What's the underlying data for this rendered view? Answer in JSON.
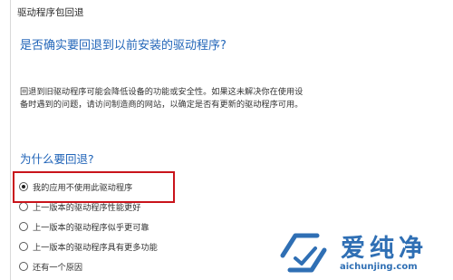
{
  "window": {
    "title": "驱动程序包回退"
  },
  "dialog": {
    "question": "是否确实要回退到以前安装的驱动程序?",
    "description_line1": "回退到旧驱动程序可能会降低设备的功能或安全性。如果这未解决你在使用设",
    "description_line2": "备时遇到的问题，请访问制造商的网站，以确定是否有更新的驱动程序可用。",
    "reason_heading": "为什么要回退?",
    "reasons": [
      {
        "label": "我的应用不使用此驱动程序",
        "selected": true
      },
      {
        "label": "上一版本的驱动程序性能更好",
        "selected": false
      },
      {
        "label": "上一版本的驱动程序似乎更可靠",
        "selected": false
      },
      {
        "label": "上一版本的驱动程序具有更多功能",
        "selected": false
      },
      {
        "label": "还有一个原因",
        "selected": false
      }
    ]
  },
  "watermark": {
    "brand": "爱纯净",
    "url": "aichunjing.com",
    "color": "#2f6fb4"
  },
  "colors": {
    "heading": "#2366b9",
    "highlight_box": "#c9141b"
  }
}
